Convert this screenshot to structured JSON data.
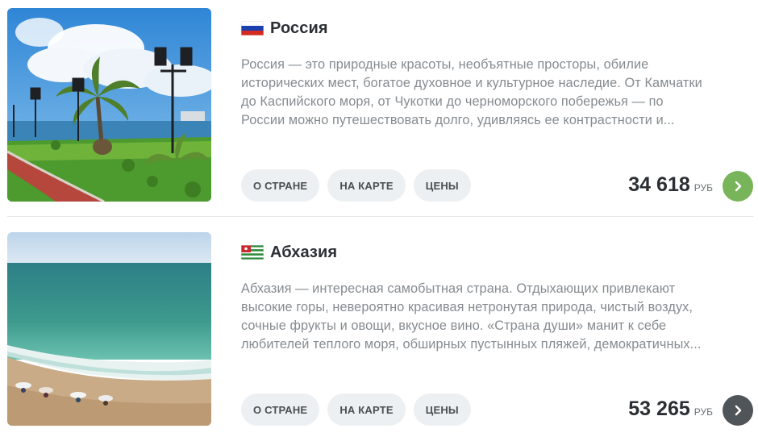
{
  "colors": {
    "accent_green": "#78b45a",
    "button_dark": "#50555a",
    "tag_bg": "#edf0f2",
    "text_muted": "#868b90"
  },
  "countries": [
    {
      "name": "Россия",
      "flag_icon": "russia-flag-icon",
      "image": "seaside-promenade-with-palms-and-lanterns",
      "description_lines": [
        "Россия — это природные красоты, необъятные просторы, обилие",
        "исторических мест, богатое духовное и культурное наследие. От Камчатки",
        "до Каспийского моря, от Чукотки до черноморского побережья — по",
        "России можно путешествовать долго, удивляясь ее контрастности и..."
      ],
      "tags": [
        "О СТРАНЕ",
        "НА КАРТЕ",
        "ЦЕНЫ"
      ],
      "price": "34 618",
      "currency": "РУБ",
      "go_button_icon": "chevron-right-icon",
      "go_button_color": "#78b45a"
    },
    {
      "name": "Абхазия",
      "flag_icon": "abkhazia-flag-icon",
      "image": "sea-coast-with-beach",
      "description_lines": [
        "Абхазия — интересная самобытная страна. Отдыхающих привлекают",
        "высокие горы, невероятно красивая нетронутая природа, чистый воздух,",
        "сочные фрукты и овощи, вкусное вино. «Страна души» манит к себе",
        "любителей теплого моря, обширных пустынных пляжей, демократичных..."
      ],
      "tags": [
        "О СТРАНЕ",
        "НА КАРТЕ",
        "ЦЕНЫ"
      ],
      "price": "53 265",
      "currency": "РУБ",
      "go_button_icon": "chevron-right-icon",
      "go_button_color": "#50555a"
    }
  ]
}
